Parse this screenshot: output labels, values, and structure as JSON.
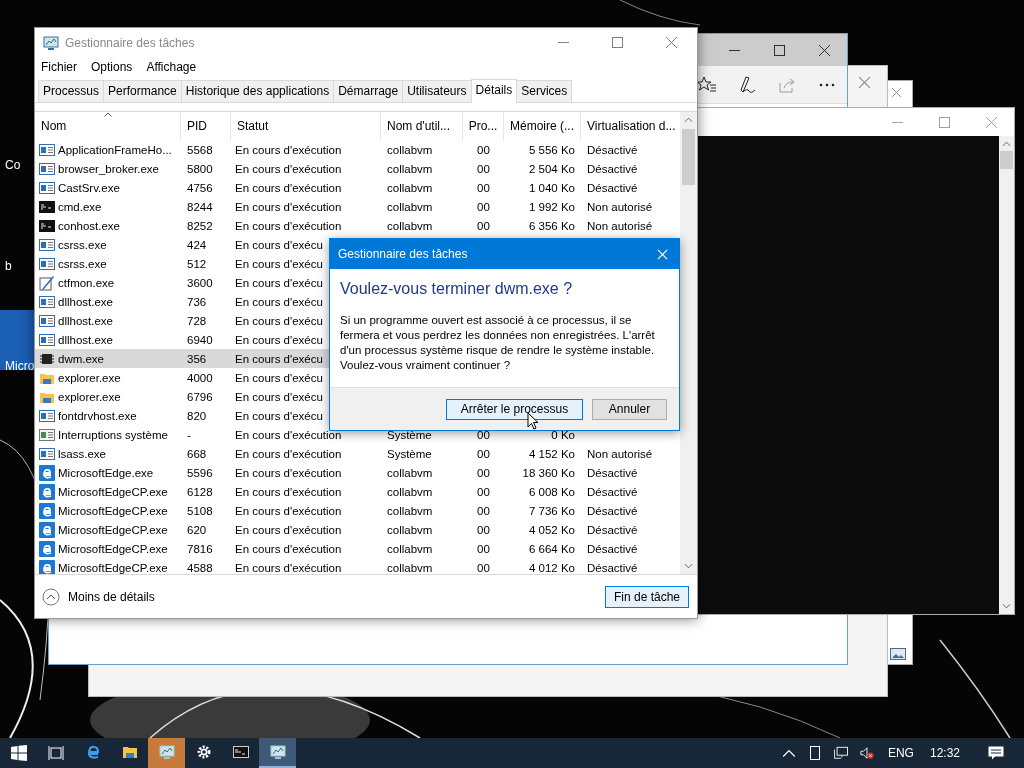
{
  "desktop": {
    "icon_labels": [
      "Co",
      "b",
      "Micro"
    ]
  },
  "task_manager": {
    "title": "Gestionnaire des tâches",
    "menu": [
      "Fichier",
      "Options",
      "Affichage"
    ],
    "tabs": [
      {
        "label": "Processus",
        "selected": false
      },
      {
        "label": "Performance",
        "selected": false
      },
      {
        "label": "Historique des applications",
        "selected": false
      },
      {
        "label": "Démarrage",
        "selected": false
      },
      {
        "label": "Utilisateurs",
        "selected": false
      },
      {
        "label": "Détails",
        "selected": true
      },
      {
        "label": "Services",
        "selected": false
      }
    ],
    "columns": [
      "Nom",
      "PID",
      "Statut",
      "Nom d'util...",
      "Pro...",
      "Mémoire (...",
      "Virtualisation d..."
    ],
    "rows": [
      {
        "kind": "app",
        "name": "ApplicationFrameHo...",
        "pid": "5568",
        "status": "En cours d'exécution",
        "user": "collabvm",
        "cpu": "00",
        "memory": "5 556 Ko",
        "virtualization": "Désactivé",
        "selected": false
      },
      {
        "kind": "app",
        "name": "browser_broker.exe",
        "pid": "5800",
        "status": "En cours d'exécution",
        "user": "collabvm",
        "cpu": "00",
        "memory": "2 504 Ko",
        "virtualization": "Désactivé",
        "selected": false
      },
      {
        "kind": "app",
        "name": "CastSrv.exe",
        "pid": "4756",
        "status": "En cours d'exécution",
        "user": "collabvm",
        "cpu": "00",
        "memory": "1 040 Ko",
        "virtualization": "Désactivé",
        "selected": false
      },
      {
        "kind": "console",
        "name": "cmd.exe",
        "pid": "8244",
        "status": "En cours d'exécution",
        "user": "collabvm",
        "cpu": "00",
        "memory": "1 992 Ko",
        "virtualization": "Non autorisé",
        "selected": false
      },
      {
        "kind": "console",
        "name": "conhost.exe",
        "pid": "8252",
        "status": "En cours d'exécution",
        "user": "collabvm",
        "cpu": "00",
        "memory": "6 356 Ko",
        "virtualization": "Non autorisé",
        "selected": false
      },
      {
        "kind": "app",
        "name": "csrss.exe",
        "pid": "424",
        "status": "En cours d'exécu",
        "selected": false
      },
      {
        "kind": "app",
        "name": "csrss.exe",
        "pid": "512",
        "status": "En cours d'exécu",
        "selected": false
      },
      {
        "kind": "pen",
        "name": "ctfmon.exe",
        "pid": "3600",
        "status": "En cours d'exécu",
        "selected": false
      },
      {
        "kind": "app",
        "name": "dllhost.exe",
        "pid": "736",
        "status": "En cours d'exécu",
        "selected": false
      },
      {
        "kind": "app",
        "name": "dllhost.exe",
        "pid": "728",
        "status": "En cours d'exécu",
        "selected": false
      },
      {
        "kind": "app",
        "name": "dllhost.exe",
        "pid": "6940",
        "status": "En cours d'exécu",
        "selected": false
      },
      {
        "kind": "chip",
        "name": "dwm.exe",
        "pid": "356",
        "status": "En cours d'exécu",
        "selected": true
      },
      {
        "kind": "folder",
        "name": "explorer.exe",
        "pid": "4000",
        "status": "En cours d'exécu",
        "selected": false
      },
      {
        "kind": "folder",
        "name": "explorer.exe",
        "pid": "6796",
        "status": "En cours d'exécu",
        "selected": false
      },
      {
        "kind": "app",
        "name": "fontdrvhost.exe",
        "pid": "820",
        "status": "En cours d'exécu",
        "selected": false
      },
      {
        "kind": "system",
        "name": "Interruptions système",
        "pid": "-",
        "status": "En cours d'exécution",
        "user": "Système",
        "cpu": "00",
        "memory": "0 Ko",
        "selected": false
      },
      {
        "kind": "app",
        "name": "lsass.exe",
        "pid": "668",
        "status": "En cours d'exécution",
        "user": "Système",
        "cpu": "00",
        "memory": "4 152 Ko",
        "virtualization": "Non autorisé",
        "selected": false
      },
      {
        "kind": "edge",
        "name": "MicrosoftEdge.exe",
        "pid": "5596",
        "status": "En cours d'exécution",
        "user": "collabvm",
        "cpu": "00",
        "memory": "18 360 Ko",
        "virtualization": "Désactivé",
        "selected": false
      },
      {
        "kind": "edge",
        "name": "MicrosoftEdgeCP.exe",
        "pid": "6128",
        "status": "En cours d'exécution",
        "user": "collabvm",
        "cpu": "00",
        "memory": "6 008 Ko",
        "virtualization": "Désactivé",
        "selected": false
      },
      {
        "kind": "edge",
        "name": "MicrosoftEdgeCP.exe",
        "pid": "5108",
        "status": "En cours d'exécution",
        "user": "collabvm",
        "cpu": "00",
        "memory": "7 736 Ko",
        "virtualization": "Désactivé",
        "selected": false
      },
      {
        "kind": "edge",
        "name": "MicrosoftEdgeCP.exe",
        "pid": "620",
        "status": "En cours d'exécution",
        "user": "collabvm",
        "cpu": "00",
        "memory": "4 052 Ko",
        "virtualization": "Désactivé",
        "selected": false
      },
      {
        "kind": "edge",
        "name": "MicrosoftEdgeCP.exe",
        "pid": "7816",
        "status": "En cours d'exécution",
        "user": "collabvm",
        "cpu": "00",
        "memory": "6 664 Ko",
        "virtualization": "Désactivé",
        "selected": false
      },
      {
        "kind": "edge",
        "name": "MicrosoftEdgeCP.exe",
        "pid": "4588",
        "status": "En cours d'exécution",
        "user": "collabvm",
        "cpu": "00",
        "memory": "4 012 Ko",
        "virtualization": "Désactivé",
        "selected": false
      }
    ],
    "less_details": "Moins de détails",
    "end_task": "Fin de tâche"
  },
  "dialog": {
    "title": "Gestionnaire des tâches",
    "heading": "Voulez-vous terminer dwm.exe ?",
    "message": "Si un programme ouvert est associé à ce processus, il se fermera et vous perdrez les données non enregistrées. L'arrêt d'un processus système risque de rendre le système instable. Voulez-vous vraiment continuer ?",
    "buttons": [
      {
        "label": "Arrêter le processus",
        "focused": true
      },
      {
        "label": "Annuler",
        "focused": false
      }
    ]
  },
  "taskbar": {
    "apps": [
      {
        "kind": "edge",
        "flashing": false,
        "selected": false
      },
      {
        "kind": "folder",
        "flashing": false,
        "selected": false
      },
      {
        "kind": "monitor",
        "flashing": true,
        "selected": false
      },
      {
        "kind": "gear",
        "flashing": false,
        "selected": false
      },
      {
        "kind": "console",
        "flashing": false,
        "selected": false
      },
      {
        "kind": "monitor",
        "flashing": false,
        "selected": true
      }
    ],
    "language": "ENG",
    "time": "12:32"
  }
}
